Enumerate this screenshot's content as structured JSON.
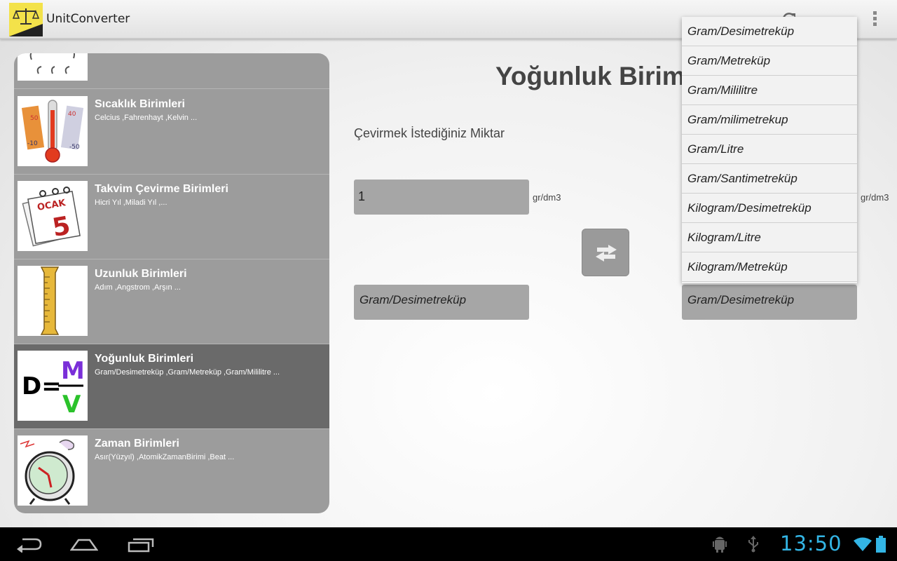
{
  "app": {
    "title": "UnitConverter"
  },
  "actionbar": {
    "refresh_icon": "refresh-icon",
    "overflow_icon": "overflow-icon"
  },
  "list": {
    "items": [
      {
        "title": "",
        "subtitle": "",
        "icon": "clouds-icon",
        "selected": false
      },
      {
        "title": "Sıcaklık Birimleri",
        "subtitle": "Celcius ,Fahrenhayt ,Kelvin ...",
        "icon": "thermometer-icon",
        "selected": false
      },
      {
        "title": "Takvim Çevirme Birimleri",
        "subtitle": "Hicri Yıl ,Miladi Yıl ,...",
        "icon": "calendar-icon",
        "calendar_month": "OCAK",
        "calendar_day": "5",
        "selected": false
      },
      {
        "title": "Uzunluk Birimleri",
        "subtitle": "Adım ,Angstrom ,Arşın ...",
        "icon": "ruler-icon",
        "selected": false
      },
      {
        "title": "Yoğunluk Birimleri",
        "subtitle": "Gram/Desimetreküp ,Gram/Metreküp ,Gram/Mililitre ...",
        "icon": "density-formula-icon",
        "formula": {
          "lhs": "D=",
          "num": "M",
          "den": "V"
        },
        "selected": true
      },
      {
        "title": "Zaman Birimleri",
        "subtitle": "Asır(Yüzyıl) ,AtomikZamanBirimi ,Beat ...",
        "icon": "alarm-clock-icon",
        "selected": false
      }
    ]
  },
  "main": {
    "title": "Yoğunluk Birim",
    "amount_label": "Çevirmek İstediğiniz Miktar",
    "amount_value": "1",
    "unit_left": "gr/dm3",
    "unit_right": "gr/dm3",
    "from_unit": "Gram/Desimetreküp",
    "to_unit": "Gram/Desimetreküp",
    "swap_icon": "swap-arrows-icon"
  },
  "dropdown": {
    "options": [
      "Gram/Desimetreküp",
      "Gram/Metreküp",
      "Gram/Mililitre",
      "Gram/milimetrekup",
      "Gram/Litre",
      "Gram/Santimetreküp",
      "Kilogram/Desimetreküp",
      "Kilogram/Litre",
      "Kilogram/Metreküp"
    ]
  },
  "system_bar": {
    "time": "13:50",
    "accent": "#33b5e5"
  }
}
